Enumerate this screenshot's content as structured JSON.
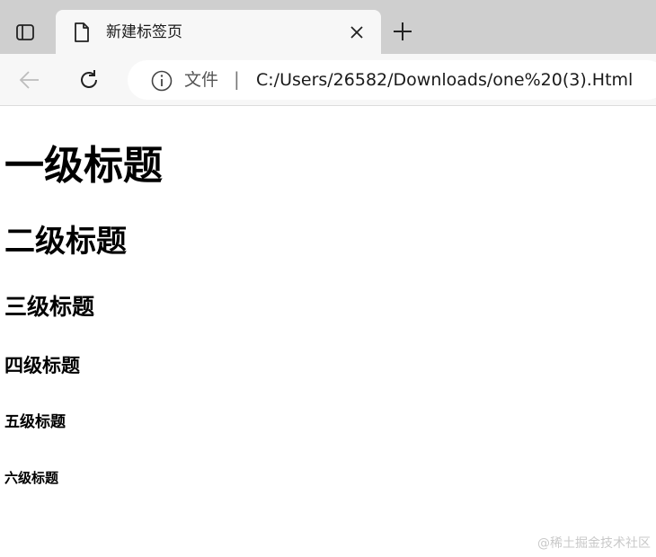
{
  "browser": {
    "tab": {
      "title": "新建标签页"
    },
    "address_bar": {
      "site_label": "文件",
      "separator": "|",
      "url": "C:/Users/26582/Downloads/one%20(3).Html"
    },
    "icons": {
      "window": "window-layout-icon",
      "favicon": "blank-page-icon",
      "close": "close-icon",
      "new_tab": "plus-icon",
      "back": "back-arrow-icon",
      "reload": "reload-icon",
      "info": "info-icon"
    }
  },
  "page": {
    "headings": {
      "h1": "一级标题",
      "h2": "二级标题",
      "h3": "三级标题",
      "h4": "四级标题",
      "h5": "五级标题",
      "h6": "六级标题"
    },
    "watermark": "@稀土掘金技术社区"
  },
  "colors": {
    "tabstrip_bg": "#cfcfcf",
    "toolbar_bg": "#f7f7f7",
    "address_bg": "#ffffff",
    "text": "#000000",
    "watermark": "#c9c9c9"
  }
}
